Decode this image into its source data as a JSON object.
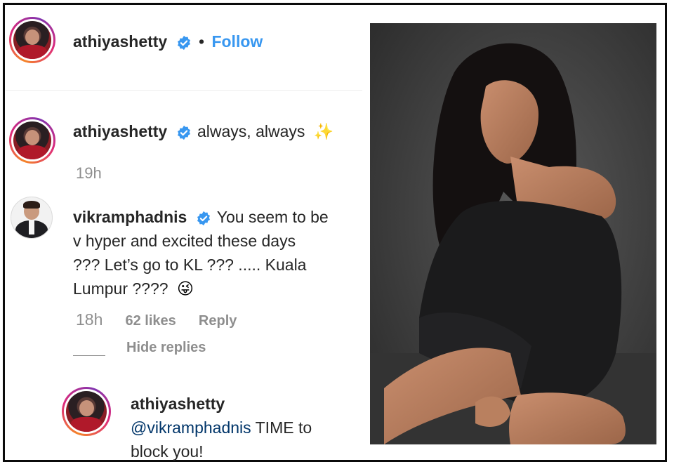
{
  "header": {
    "username": "athiyashetty",
    "separator": "•",
    "follow_label": "Follow"
  },
  "comments": [
    {
      "username": "athiyashetty",
      "text": "always, always",
      "emoji": "✨",
      "time": "19h"
    },
    {
      "username": "vikramphadnis",
      "lines": [
        "You seem to be",
        "v hyper and excited these days",
        "??? Let’s go to KL ??? ..... Kuala",
        "Lumpur ????"
      ],
      "emoji": "😜",
      "time": "18h",
      "likes": "62 likes",
      "reply_label": "Reply",
      "hide_replies_label": "Hide replies"
    },
    {
      "username": "athiyashetty",
      "mention": "@vikramphadnis",
      "lines_after_mention": "TIME to",
      "line2": "block you!"
    }
  ],
  "colors": {
    "verified": "#3897f0",
    "link": "#3897f0",
    "meta": "#8e8e8e",
    "text": "#262626",
    "mention": "#003569"
  },
  "icons": [
    "verified-badge-icon",
    "sparkles-emoji-icon",
    "winking-tongue-emoji-icon"
  ]
}
